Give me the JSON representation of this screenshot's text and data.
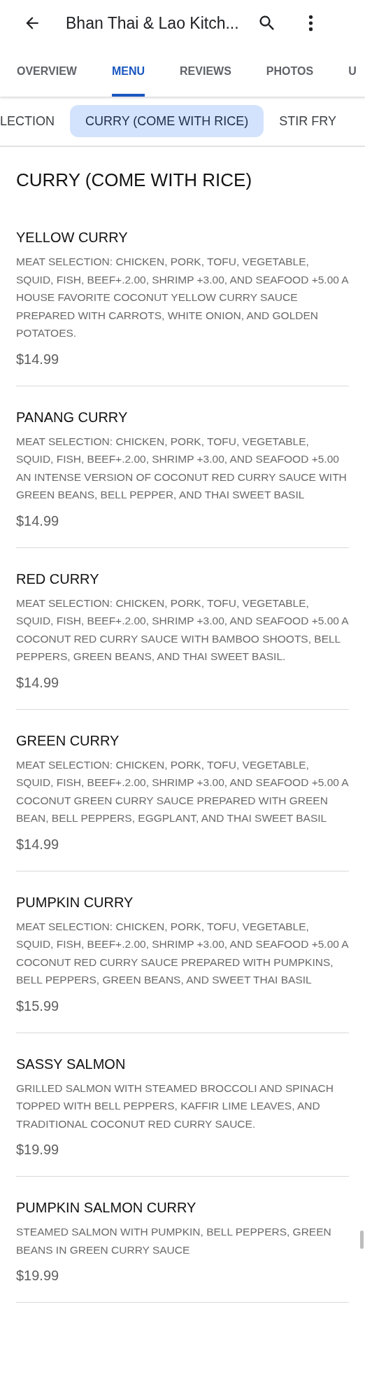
{
  "header": {
    "title": "Bhan Thai & Lao Kitch..."
  },
  "tabs": [
    {
      "label": "OVERVIEW",
      "selected": false
    },
    {
      "label": "MENU",
      "selected": true
    },
    {
      "label": "REVIEWS",
      "selected": false
    },
    {
      "label": "PHOTOS",
      "selected": false
    },
    {
      "label": "U",
      "selected": false
    }
  ],
  "categories": [
    {
      "label": "LECTION",
      "selected": false
    },
    {
      "label": "CURRY (COME WITH RICE)",
      "selected": true
    },
    {
      "label": "STIR FRY",
      "selected": false
    }
  ],
  "section_title": "CURRY (COME WITH RICE)",
  "items": [
    {
      "name": "YELLOW CURRY",
      "description": "MEAT SELECTION: CHICKEN, PORK, TOFU, VEGETABLE, SQUID, FISH, BEEF+.2.00, SHRIMP +3.00, AND SEAFOOD +5.00 A HOUSE FAVORITE COCONUT YELLOW CURRY SAUCE PREPARED WITH CARROTS, WHITE ONION, AND GOLDEN POTATOES.",
      "price": "$14.99"
    },
    {
      "name": "PANANG CURRY",
      "description": "MEAT SELECTION: CHICKEN, PORK, TOFU, VEGETABLE, SQUID, FISH, BEEF+.2.00, SHRIMP +3.00, AND SEAFOOD +5.00 AN INTENSE VERSION OF COCONUT RED CURRY SAUCE WITH GREEN BEANS, BELL PEPPER, AND THAI SWEET BASIL",
      "price": "$14.99"
    },
    {
      "name": "RED CURRY",
      "description": "MEAT SELECTION: CHICKEN, PORK, TOFU, VEGETABLE, SQUID, FISH, BEEF+.2.00, SHRIMP +3.00, AND SEAFOOD +5.00 A COCONUT RED CURRY SAUCE WITH BAMBOO SHOOTS, BELL PEPPERS, GREEN BEANS, AND THAI SWEET BASIL.",
      "price": "$14.99"
    },
    {
      "name": "GREEN CURRY",
      "description": "MEAT SELECTION: CHICKEN, PORK, TOFU, VEGETABLE, SQUID, FISH, BEEF+.2.00, SHRIMP +3.00, AND SEAFOOD +5.00 A COCONUT GREEN CURRY SAUCE PREPARED WITH GREEN BEAN, BELL PEPPERS, EGGPLANT, AND THAI SWEET BASIL",
      "price": "$14.99"
    },
    {
      "name": "PUMPKIN CURRY",
      "description": "MEAT SELECTION: CHICKEN, PORK, TOFU, VEGETABLE, SQUID, FISH, BEEF+.2.00, SHRIMP +3.00, AND SEAFOOD +5.00 A COCONUT RED CURRY SAUCE PREPARED WITH PUMPKINS, BELL PEPPERS, GREEN BEANS, AND SWEET THAI BASIL",
      "price": "$15.99"
    },
    {
      "name": "SASSY SALMON",
      "description": "GRILLED SALMON WITH STEAMED BROCCOLI AND SPINACH TOPPED WITH BELL PEPPERS, KAFFIR LIME LEAVES, AND TRADITIONAL COCONUT RED CURRY SAUCE.",
      "price": "$19.99"
    },
    {
      "name": "PUMPKIN SALMON CURRY",
      "description": "STEAMED SALMON WITH PUMPKIN, BELL PEPPERS, GREEN BEANS IN GREEN CURRY SAUCE",
      "price": "$19.99"
    }
  ]
}
